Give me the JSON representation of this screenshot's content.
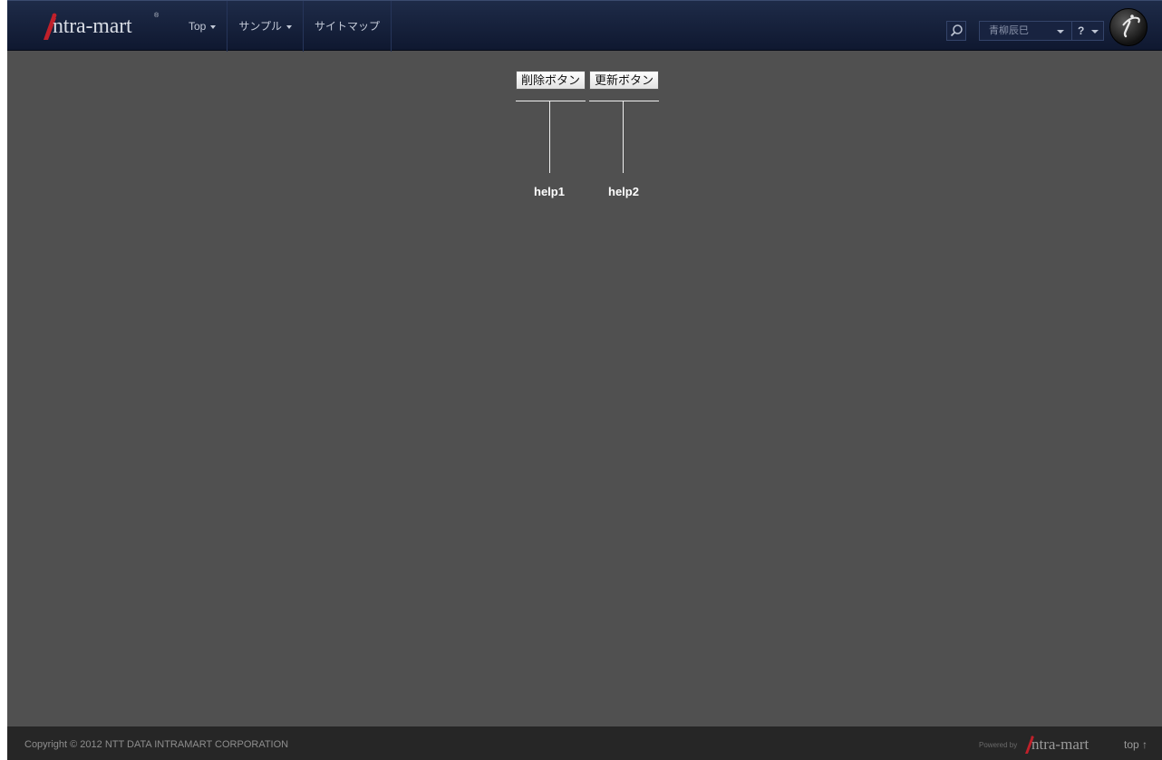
{
  "header": {
    "logo_text": "ntra-mart",
    "logo_reg": "®",
    "nav": [
      {
        "label": "Top"
      },
      {
        "label": "サンプル"
      },
      {
        "label": "サイトマップ"
      }
    ],
    "user_name": "青柳辰巳",
    "help_label": "?"
  },
  "main": {
    "delete_button": "削除ボタン",
    "update_button": "更新ボタン",
    "help1": "help1",
    "help2": "help2"
  },
  "footer": {
    "copyright": "Copyright © 2012 NTT DATA INTRAMART CORPORATION",
    "powered_by": "Powered by",
    "logo_text": "ntra-mart",
    "top_link": "top ↑"
  },
  "colors": {
    "header_bg": "#1e2b48",
    "content_bg": "#505050",
    "footer_bg": "#262626",
    "logo_accent": "#c0202a"
  }
}
